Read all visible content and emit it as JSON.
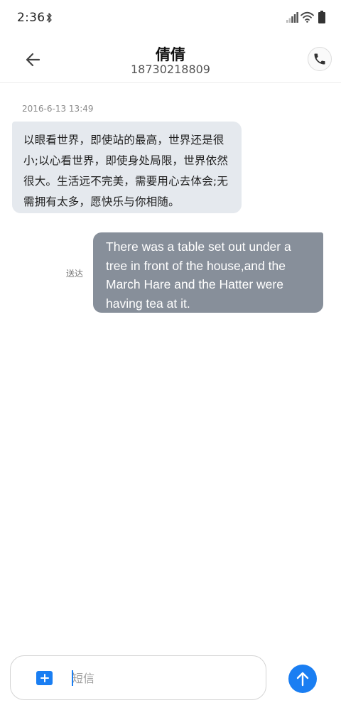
{
  "status_bar": {
    "time": "2:36",
    "icons": [
      "bluetooth-icon",
      "signal-icon",
      "wifi-icon",
      "battery-icon"
    ]
  },
  "header": {
    "contact_name": "倩倩",
    "contact_number": "18730218809",
    "back_icon": "arrow-left-icon",
    "call_icon": "phone-icon"
  },
  "conversation": {
    "timestamp": "2016-6-13 13:49",
    "incoming_message": "以眼看世界，即使站的最高，世界还是很小;以心看世界，即使身处局限，世界依然很大。生活远不完美，需要用心去体会;无需拥有太多，愿快乐与你相随。",
    "outgoing_message": "There was a table set out under a tree in front of the house,and the March Hare and the Hatter were having tea at it.",
    "outgoing_status": "送达"
  },
  "compose": {
    "placeholder": "短信",
    "attach_icon": "plus-icon",
    "send_icon": "arrow-up-icon"
  },
  "colors": {
    "accent": "#1a7ef2",
    "incoming_bubble": "#e5e9ee",
    "outgoing_bubble": "#878f9a"
  }
}
